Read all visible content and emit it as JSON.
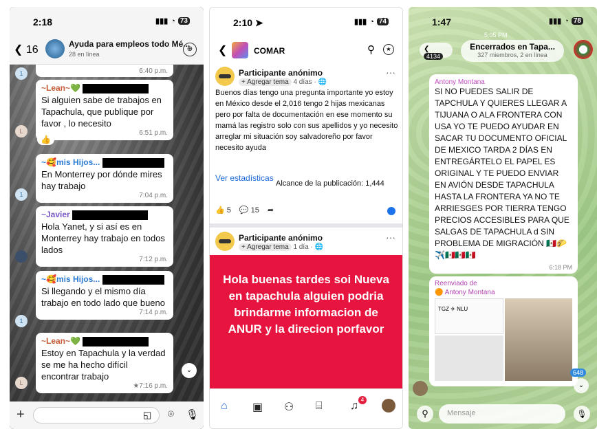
{
  "whatsapp": {
    "status_time": "2:18",
    "battery": "73",
    "back_count": "16",
    "group_name": "Ayuda para empleos todo Mé...",
    "online": "28 en línea",
    "first_time": "6:40 p.m.",
    "messages": [
      {
        "sender": "~Lean~💚",
        "text": "Si alguien sabe de trabajos en Tapachula, que publique por favor , lo necesito",
        "time": "6:51 p.m."
      },
      {
        "sender": "~🥰mis Hijos...",
        "text": "En Monterrey por dónde mires hay trabajo",
        "time": "7:04 p.m."
      },
      {
        "sender": "~Javier",
        "text": "Hola Yanet, y si así es en Monterrey hay trabajo en todos lados",
        "time": "7:12 p.m."
      },
      {
        "sender": "~🥰mis Hijos...",
        "text": "Si llegando y el mismo día trabajo en todo lado que bueno",
        "time": "7:14 p.m."
      },
      {
        "sender": "~Lean~💚",
        "text": "Estoy en Tapachula y la verdad se me ha hecho difícil encontrar trabajo",
        "time": "★7:16 p.m."
      }
    ],
    "reaction": "👍"
  },
  "facebook": {
    "status_time": "2:10",
    "battery": "74",
    "page_name": "COMAR",
    "post1": {
      "author": "Participante anónimo",
      "tag": "+ Agregar tema",
      "meta": "4 días · 🌐",
      "text": "Buenos días tengo una pregunta importante yo estoy en México desde el 2,016 tengo 2 hijas mexicanas pero por falta de documentación en ese momento su mamá las registro solo con sus apellidos y yo necesito arreglar mi situación soy salvadoreño por favor necesito ayuda",
      "link": "Ver estadísticas",
      "reach": "Alcance de la publicación: 1,444",
      "likes": "5",
      "comments": "15"
    },
    "post2": {
      "author": "Participante anónimo",
      "tag": "+ Agregar tema",
      "meta": "1 día · 🌐",
      "text": "Hola buenas tardes soi Nueva en tapachula alguien podria brindarme informacion de ANUR y la direcion porfavor"
    },
    "notif_count": "4"
  },
  "telegram": {
    "status_time": "1:47",
    "battery": "78",
    "back_count": "4134",
    "group_name": "Encerrados en Tapa...",
    "members": "327 miembros, 2 en línea",
    "date_label": "5:05 PM",
    "msg_sender": "Antony Montana",
    "msg_text": "SI NO PUEDES SALIR DE TAPCHULA Y QUIERES LLEGAR A TIJUANA O ALA FRONTERA CON USA YO TE PUEDO AYUDAR EN SACAR TU DOCUMENTO OFICIAL DE MEXICO TARDA 2  DÍAS EN ENTREGÁRTELO EL PAPEL ES ORIGINAL Y TE PUEDO ENVIAR EN AVIÓN DESDE TAPACHULA HASTA LA FRONTERA YA NO TE ARRIESGES POR TIERRA TENGO PRECIOS ACCESIBLES PARA QUE SALGAS DE TAPACHULA d SIN PROBLEMA DE MIGRACIÓN 🇲🇽🌮 ✈️🇲🇽🇲🇽🇲🇽",
    "msg_time": "6:18 PM",
    "fwd_label": "Reenviado de",
    "fwd_from": "🟠 Antony Montana",
    "ticket_from": "TGZ",
    "ticket_to": "NLU",
    "unread_badge": "648",
    "input_placeholder": "Mensaje"
  }
}
